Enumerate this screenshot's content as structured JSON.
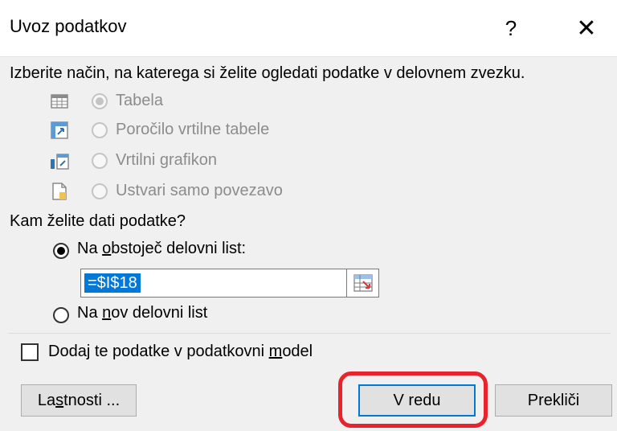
{
  "dialog": {
    "title": "Uvoz podatkov",
    "help_label": "?",
    "close_label": "✕"
  },
  "view_section": {
    "prompt": "Izberite način, na katerega si želite ogledati podatke v delovnem zvezku.",
    "options": [
      {
        "label": "Tabela",
        "selected": true,
        "enabled": false,
        "icon": "table-icon"
      },
      {
        "label": "Poročilo vrtilne tabele",
        "selected": false,
        "enabled": false,
        "icon": "pivot-table-icon"
      },
      {
        "label": "Vrtilni grafikon",
        "selected": false,
        "enabled": false,
        "icon": "pivot-chart-icon"
      },
      {
        "label": "Ustvari samo povezavo",
        "selected": false,
        "enabled": false,
        "icon": "connection-only-icon"
      }
    ]
  },
  "location_section": {
    "prompt": "Kam želite dati podatke?",
    "existing": {
      "label_pre": "Na ",
      "label_u": "o",
      "label_post": "bstoječ delovni list:",
      "selected": true
    },
    "range_value": "=$I$18",
    "new_sheet": {
      "label_pre": "Na ",
      "label_u": "n",
      "label_post": "ov delovni list",
      "selected": false
    }
  },
  "data_model": {
    "label_pre": "Dodaj te podatke v podatkovni ",
    "label_u": "m",
    "label_post": "odel",
    "checked": false
  },
  "buttons": {
    "properties_pre": "La",
    "properties_u": "s",
    "properties_post": "tnosti ...",
    "ok": "V redu",
    "cancel": "Prekliči"
  },
  "colors": {
    "highlight": "#e8232b",
    "accent": "#0078d7"
  }
}
